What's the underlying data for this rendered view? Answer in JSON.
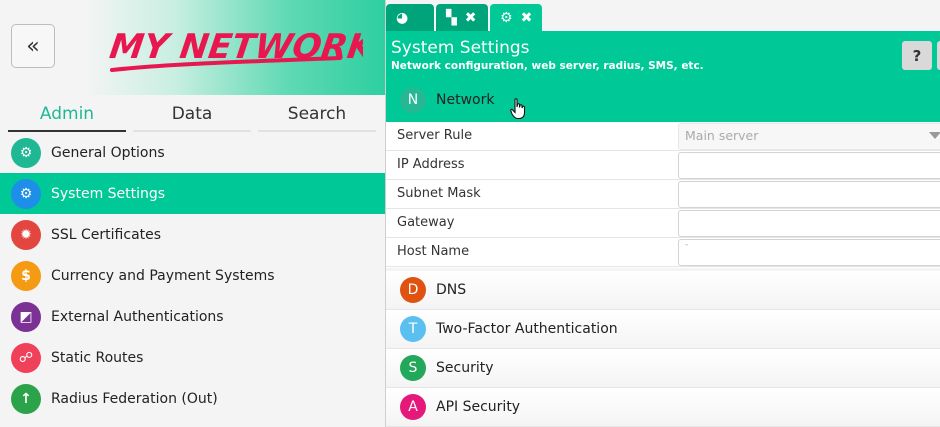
{
  "logo": {
    "text": "MY NETWORK"
  },
  "collapse_icon": "double-chevron-left",
  "left_tabs": [
    {
      "label": "Admin",
      "active": true
    },
    {
      "label": "Data",
      "active": false
    },
    {
      "label": "Search",
      "active": false
    }
  ],
  "menu": [
    {
      "label": "General Options",
      "icon": "gears-icon",
      "glyph": "⚙",
      "color": "#1fb894",
      "active": false
    },
    {
      "label": "System Settings",
      "icon": "gear-icon",
      "glyph": "⚙",
      "color": "#1e8fe8",
      "active": true
    },
    {
      "label": "SSL Certificates",
      "icon": "certificate-icon",
      "glyph": "✹",
      "color": "#e2463f",
      "active": false
    },
    {
      "label": "Currency and Payment Systems",
      "icon": "dollar-icon",
      "glyph": "$",
      "color": "#f59b13",
      "active": false
    },
    {
      "label": "External Authentications",
      "icon": "external-auth-icon",
      "glyph": "◩",
      "color": "#7b3294",
      "active": false
    },
    {
      "label": "Static Routes",
      "icon": "sitemap-icon",
      "glyph": "☍",
      "color": "#f0415a",
      "active": false
    },
    {
      "label": "Radius Federation (Out)",
      "icon": "arrow-up-circle-icon",
      "glyph": "↑",
      "color": "#2ba34a",
      "active": false
    }
  ],
  "right_tabs": [
    {
      "icon": "dashboard-icon",
      "glyph": "◕",
      "closable": false
    },
    {
      "icon": "grid-icon",
      "glyph": "▚",
      "closable": true
    },
    {
      "icon": "gear-icon",
      "glyph": "⚙",
      "closable": true,
      "active": true
    }
  ],
  "close_glyph": "✖",
  "header": {
    "title": "System Settings",
    "subtitle": "Network configuration, web server, radius, SMS, etc.",
    "help_label": "?"
  },
  "network": {
    "letter": "N",
    "label": "Network",
    "color": "#26b894"
  },
  "form": {
    "server_rule": {
      "label": "Server Rule",
      "value": "Main server"
    },
    "ip_address": {
      "label": "IP Address",
      "value": ""
    },
    "subnet_mask": {
      "label": "Subnet Mask",
      "value": ""
    },
    "gateway": {
      "label": "Gateway",
      "value": ""
    },
    "host_name": {
      "label": "Host Name",
      "value": "-"
    }
  },
  "sections": [
    {
      "letter": "D",
      "label": "DNS",
      "color": "#e0520f"
    },
    {
      "letter": "T",
      "label": "Two-Factor Authentication",
      "color": "#5bc0f0"
    },
    {
      "letter": "S",
      "label": "Security",
      "color": "#22a85a"
    },
    {
      "letter": "A",
      "label": "API Security",
      "color": "#e5197a"
    }
  ]
}
